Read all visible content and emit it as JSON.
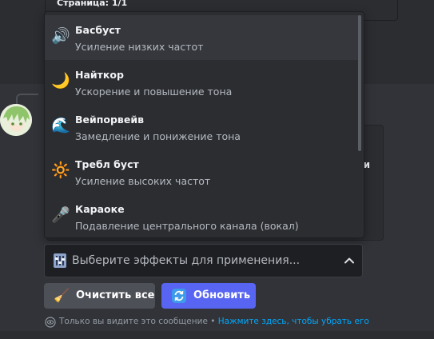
{
  "previous_embed": {
    "text": "Страница: 1/1"
  },
  "embed_card": {
    "visible_text": "и"
  },
  "dropdown": {
    "options": [
      {
        "icon": "speaker-icon",
        "glyph": "🔊",
        "label": "Басбуст",
        "description": "Усиление низких частот"
      },
      {
        "icon": "moon-icon",
        "glyph": "🌙",
        "label": "Найткор",
        "description": "Ускорение и повышение тона"
      },
      {
        "icon": "wave-icon",
        "glyph": "🌊",
        "label": "Вейпорвейв",
        "description": "Замедление и понижение тона"
      },
      {
        "icon": "sun-icon",
        "glyph": "🔆",
        "label": "Требл буст",
        "description": "Усиление высоких частот"
      },
      {
        "icon": "microphone-icon",
        "glyph": "🎤",
        "label": "Караоке",
        "description": "Подавление центрального канала (вокал)"
      }
    ]
  },
  "select": {
    "placeholder": "Выберите эффекты для применения..."
  },
  "buttons": {
    "clear_label": "Очистить все",
    "update_label": "Обновить"
  },
  "ephemeral": {
    "text": "Только вы видите это сообщение • ",
    "link": "Нажмите здесь, чтобы убрать его"
  },
  "colors": {
    "background": "#313338",
    "secondary_background": "#2b2d31",
    "blurple": "#5865f2",
    "link": "#00a8fc"
  }
}
